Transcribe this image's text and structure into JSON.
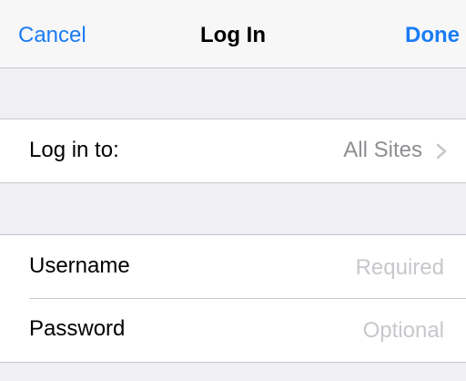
{
  "navbar": {
    "cancel_label": "Cancel",
    "title": "Log In",
    "done_label": "Done"
  },
  "site_row": {
    "label": "Log in to:",
    "value": "All Sites",
    "icon": "chevron-right-icon"
  },
  "credentials": {
    "username": {
      "label": "Username",
      "value": "",
      "placeholder": "Required"
    },
    "password": {
      "label": "Password",
      "value": "",
      "placeholder": "Optional"
    }
  },
  "colors": {
    "accent": "#1a7cf3",
    "background": "#efeff4",
    "secondary_text": "#8e8e93",
    "placeholder": "#c7c7cd",
    "separator": "#c8c7cc"
  }
}
